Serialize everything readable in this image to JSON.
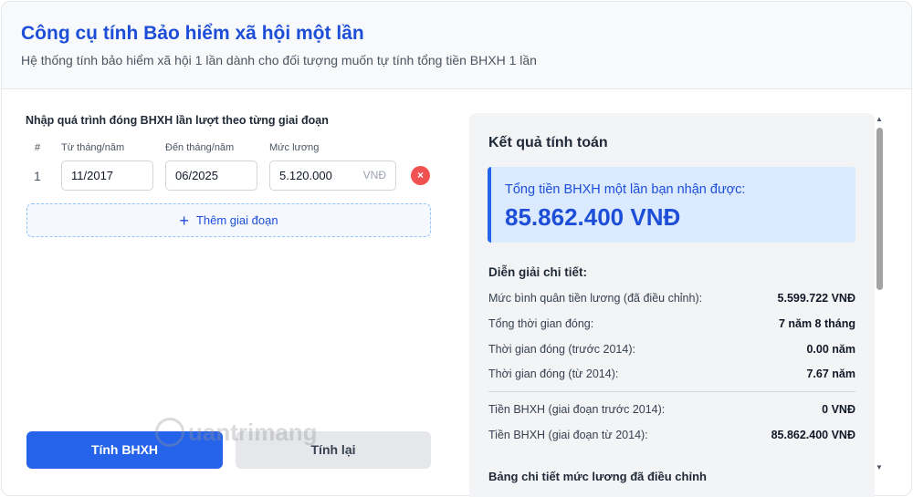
{
  "header": {
    "title": "Công cụ tính Bảo hiểm xã hội một lần",
    "subtitle": "Hệ thống tính bảo hiểm xã hội 1 lần dành cho đối tượng muốn tự tính tổng tiền BHXH 1 lần"
  },
  "form": {
    "title": "Nhập quá trình đóng BHXH lần lượt theo từng giai đoạn",
    "columns": {
      "index": "#",
      "from": "Từ tháng/năm",
      "to": "Đến tháng/năm",
      "salary": "Mức lương"
    },
    "rows": [
      {
        "index": "1",
        "from": "11/2017",
        "to": "06/2025",
        "salary": "5.120.000",
        "unit": "VNĐ",
        "remove": "×"
      }
    ],
    "add_label": "Thêm giai đoạn",
    "add_icon": "+"
  },
  "buttons": {
    "calculate": "Tính BHXH",
    "reset": "Tính lại"
  },
  "watermark": "uantrimang",
  "result": {
    "title": "Kết quả tính toán",
    "total_label": "Tổng tiền BHXH một lần bạn nhận được:",
    "total_value": "85.862.400 VNĐ",
    "detail_title": "Diễn giải chi tiết:",
    "details": [
      {
        "label": "Mức bình quân tiền lương (đã điều chỉnh):",
        "value": "5.599.722 VNĐ"
      },
      {
        "label": "Tổng thời gian đóng:",
        "value": "7 năm 8 tháng"
      },
      {
        "label": "Thời gian đóng (trước 2014):",
        "value": "0.00 năm"
      },
      {
        "label": "Thời gian đóng (từ 2014):",
        "value": "7.67 năm"
      },
      {
        "label": "Tiền BHXH (giai đoạn trước 2014):",
        "value": "0 VNĐ"
      },
      {
        "label": "Tiền BHXH (giai đoạn từ 2014):",
        "value": "85.862.400 VNĐ"
      }
    ],
    "cutoff_text": "Bảng chi tiết mức lương đã điều chỉnh"
  },
  "colors": {
    "accent": "#2563eb",
    "danger": "#f05252",
    "total_bg": "#dbeafe"
  }
}
